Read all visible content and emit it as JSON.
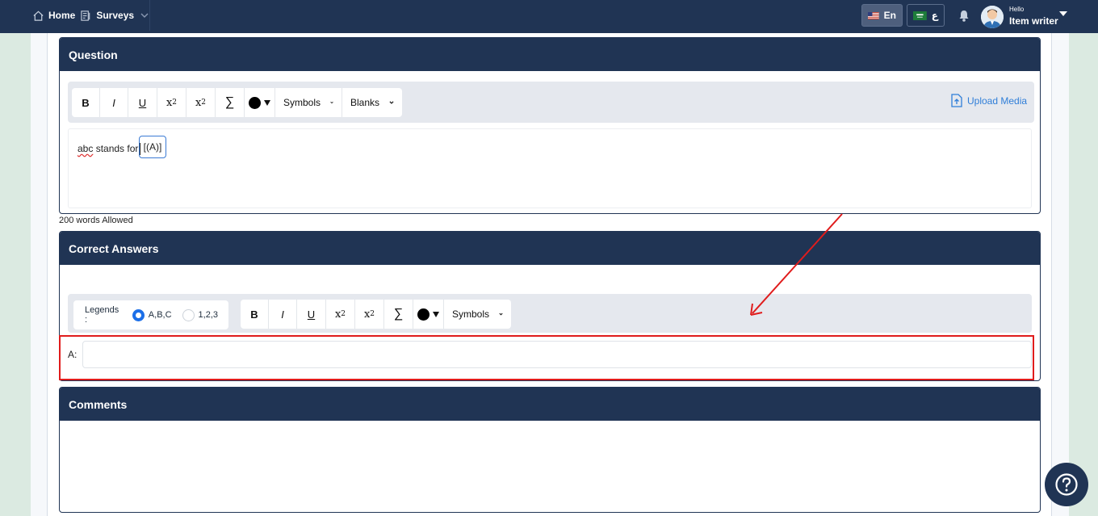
{
  "nav": {
    "home_label": "Home",
    "surveys_label": "Surveys"
  },
  "header": {
    "lang_en_label": "En",
    "lang_ar_label": "ع",
    "greeting": "Hello",
    "user_name": "Item writer"
  },
  "question": {
    "title": "Question",
    "toolbar": {
      "bold": "B",
      "italic": "I",
      "underline": "U",
      "subscript_base": "x",
      "subscript_mark": "2",
      "superscript_base": "x",
      "superscript_mark": "2",
      "sum": "∑",
      "symbols_label": "Symbols",
      "blanks_label": "Blanks"
    },
    "upload_label": "Upload Media",
    "editor_word": "abc",
    "editor_rest": " stands for",
    "blank_chip": "[(A)]",
    "word_limit": "200 words Allowed"
  },
  "answers": {
    "title": "Correct Answers",
    "legends_label": "Legends :",
    "legend_options": [
      "A,B,C",
      "1,2,3"
    ],
    "legend_selected": "A,B,C",
    "toolbar": {
      "bold": "B",
      "italic": "I",
      "underline": "U",
      "subscript_base": "x",
      "subscript_mark": "2",
      "superscript_base": "x",
      "superscript_mark": "2",
      "sum": "∑",
      "symbols_label": "Symbols"
    },
    "answer_label": "A:",
    "answer_value": ""
  },
  "comments": {
    "title": "Comments"
  },
  "colors": {
    "navy": "#203454",
    "accent_blue": "#1c6fe8",
    "annotation_red": "#e01c1c",
    "background_green": "#dbeae1"
  }
}
